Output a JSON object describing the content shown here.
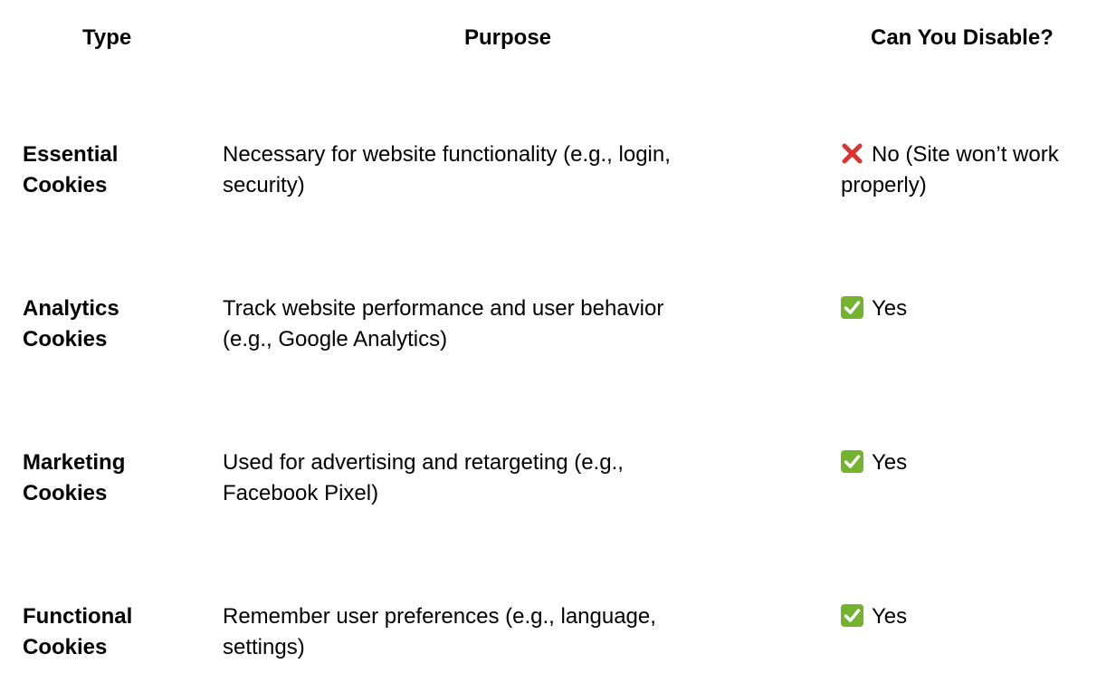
{
  "header": {
    "type": "Type",
    "purpose": "Purpose",
    "disable": "Can You Disable?"
  },
  "rows": [
    {
      "type_line1": "Essential",
      "type_line2": "Cookies",
      "purpose_line1": "Necessary for website functionality (e.g., login,",
      "purpose_line2": "security)",
      "disable_icon": "cross-mark-icon",
      "disable_line1": "No (Site won’t work",
      "disable_line2": "properly)"
    },
    {
      "type_line1": "Analytics",
      "type_line2": "Cookies",
      "purpose_line1": "Track website performance and user behavior",
      "purpose_line2": "(e.g., Google Analytics)",
      "disable_icon": "check-mark-icon",
      "disable_line1": "Yes",
      "disable_line2": ""
    },
    {
      "type_line1": "Marketing",
      "type_line2": "Cookies",
      "purpose_line1": "Used for advertising and retargeting (e.g.,",
      "purpose_line2": "Facebook Pixel)",
      "disable_icon": "check-mark-icon",
      "disable_line1": "Yes",
      "disable_line2": ""
    },
    {
      "type_line1": "Functional",
      "type_line2": "Cookies",
      "purpose_line1": "Remember user preferences (e.g., language,",
      "purpose_line2": "settings)",
      "disable_icon": "check-mark-icon",
      "disable_line1": "Yes",
      "disable_line2": ""
    }
  ],
  "colors": {
    "cross_red": "#E0322B",
    "check_green": "#74B32F"
  }
}
